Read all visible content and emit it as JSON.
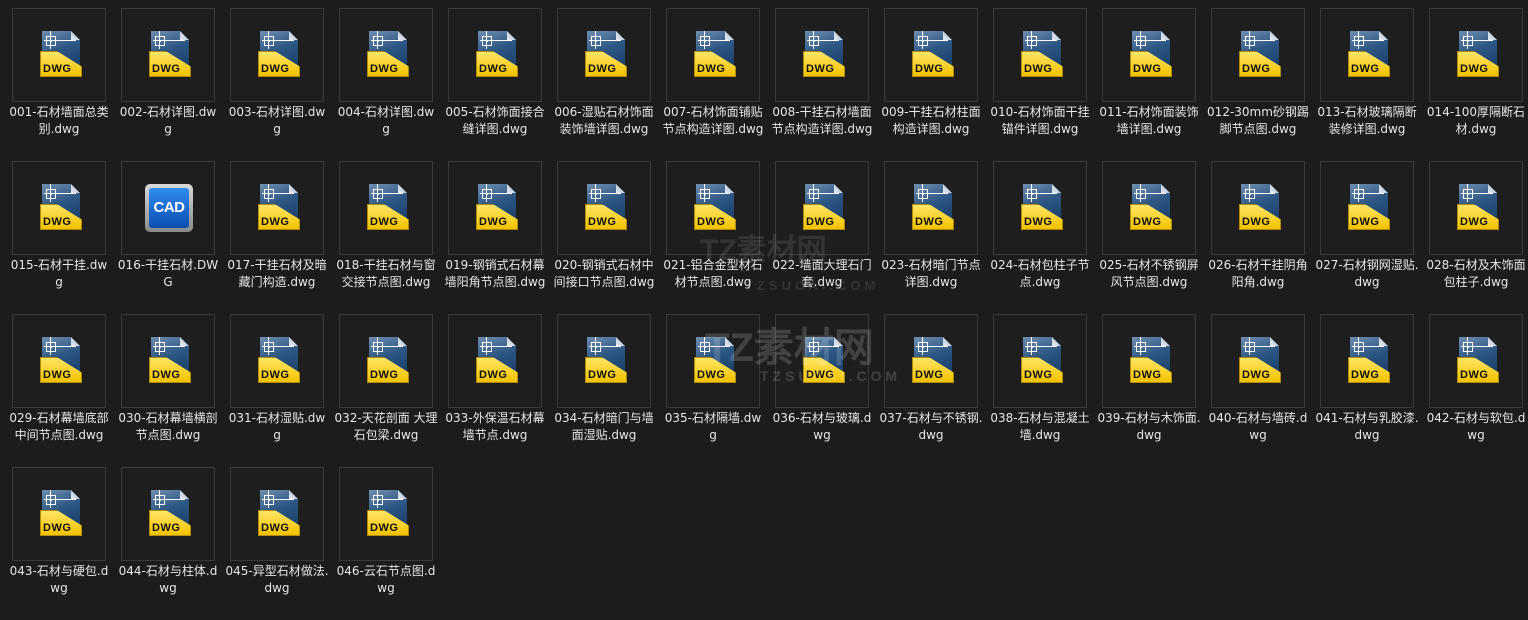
{
  "icons": {
    "dwg_label": "DWG",
    "cad_label": "CAD"
  },
  "watermark": {
    "text": "TZ素材网",
    "sub": "TZSUCAI.COM"
  },
  "files": [
    {
      "name": "001-石材墙面总类别.dwg",
      "icon": "dwg"
    },
    {
      "name": "002-石材详图.dwg",
      "icon": "dwg"
    },
    {
      "name": "003-石材详图.dwg",
      "icon": "dwg"
    },
    {
      "name": "004-石材详图.dwg",
      "icon": "dwg"
    },
    {
      "name": "005-石材饰面接合缝详图.dwg",
      "icon": "dwg"
    },
    {
      "name": "006-湿贴石材饰面装饰墙详图.dwg",
      "icon": "dwg"
    },
    {
      "name": "007-石材饰面铺贴节点构造详图.dwg",
      "icon": "dwg"
    },
    {
      "name": "008-干挂石材墙面节点构造详图.dwg",
      "icon": "dwg"
    },
    {
      "name": "009-干挂石材柱面构造详图.dwg",
      "icon": "dwg"
    },
    {
      "name": "010-石材饰面干挂锚件详图.dwg",
      "icon": "dwg"
    },
    {
      "name": "011-石材饰面装饰墙详图.dwg",
      "icon": "dwg"
    },
    {
      "name": "012-30mm砂钢踢脚节点图.dwg",
      "icon": "dwg"
    },
    {
      "name": "013-石材玻璃隔断装修详图.dwg",
      "icon": "dwg"
    },
    {
      "name": "014-100厚隔断石材.dwg",
      "icon": "dwg"
    },
    {
      "name": "015-石材干挂.dwg",
      "icon": "dwg"
    },
    {
      "name": "016-干挂石材.DWG",
      "icon": "cad"
    },
    {
      "name": "017-干挂石材及暗藏门构造.dwg",
      "icon": "dwg"
    },
    {
      "name": "018-干挂石材与窗交接节点图.dwg",
      "icon": "dwg"
    },
    {
      "name": "019-钢销式石材幕墙阳角节点图.dwg",
      "icon": "dwg"
    },
    {
      "name": "020-钢销式石材中间接口节点图.dwg",
      "icon": "dwg"
    },
    {
      "name": "021-铝合金型材石材节点图.dwg",
      "icon": "dwg"
    },
    {
      "name": "022-墙面大理石门套.dwg",
      "icon": "dwg"
    },
    {
      "name": "023-石材暗门节点详图.dwg",
      "icon": "dwg"
    },
    {
      "name": "024-石材包柱子节点.dwg",
      "icon": "dwg"
    },
    {
      "name": "025-石材不锈钢屏风节点图.dwg",
      "icon": "dwg"
    },
    {
      "name": "026-石材干挂阴角阳角.dwg",
      "icon": "dwg"
    },
    {
      "name": "027-石材钢网湿贴.dwg",
      "icon": "dwg"
    },
    {
      "name": "028-石材及木饰面包柱子.dwg",
      "icon": "dwg"
    },
    {
      "name": "029-石材幕墙底部中间节点图.dwg",
      "icon": "dwg"
    },
    {
      "name": "030-石材幕墙横剖节点图.dwg",
      "icon": "dwg"
    },
    {
      "name": "031-石材湿贴.dwg",
      "icon": "dwg"
    },
    {
      "name": "032-天花剖面 大理石包梁.dwg",
      "icon": "dwg"
    },
    {
      "name": "033-外保温石材幕墙节点.dwg",
      "icon": "dwg"
    },
    {
      "name": "034-石材暗门与墙面湿贴.dwg",
      "icon": "dwg"
    },
    {
      "name": "035-石材隔墙.dwg",
      "icon": "dwg"
    },
    {
      "name": "036-石材与玻璃.dwg",
      "icon": "dwg"
    },
    {
      "name": "037-石材与不锈钢.dwg",
      "icon": "dwg"
    },
    {
      "name": "038-石材与混凝土墙.dwg",
      "icon": "dwg"
    },
    {
      "name": "039-石材与木饰面.dwg",
      "icon": "dwg"
    },
    {
      "name": "040-石材与墙砖.dwg",
      "icon": "dwg"
    },
    {
      "name": "041-石材与乳胶漆.dwg",
      "icon": "dwg"
    },
    {
      "name": "042-石材与软包.dwg",
      "icon": "dwg"
    },
    {
      "name": "043-石材与硬包.dwg",
      "icon": "dwg"
    },
    {
      "name": "044-石材与柱体.dwg",
      "icon": "dwg"
    },
    {
      "name": "045-异型石材做法.dwg",
      "icon": "dwg"
    },
    {
      "name": "046-云石节点图.dwg",
      "icon": "dwg"
    }
  ]
}
